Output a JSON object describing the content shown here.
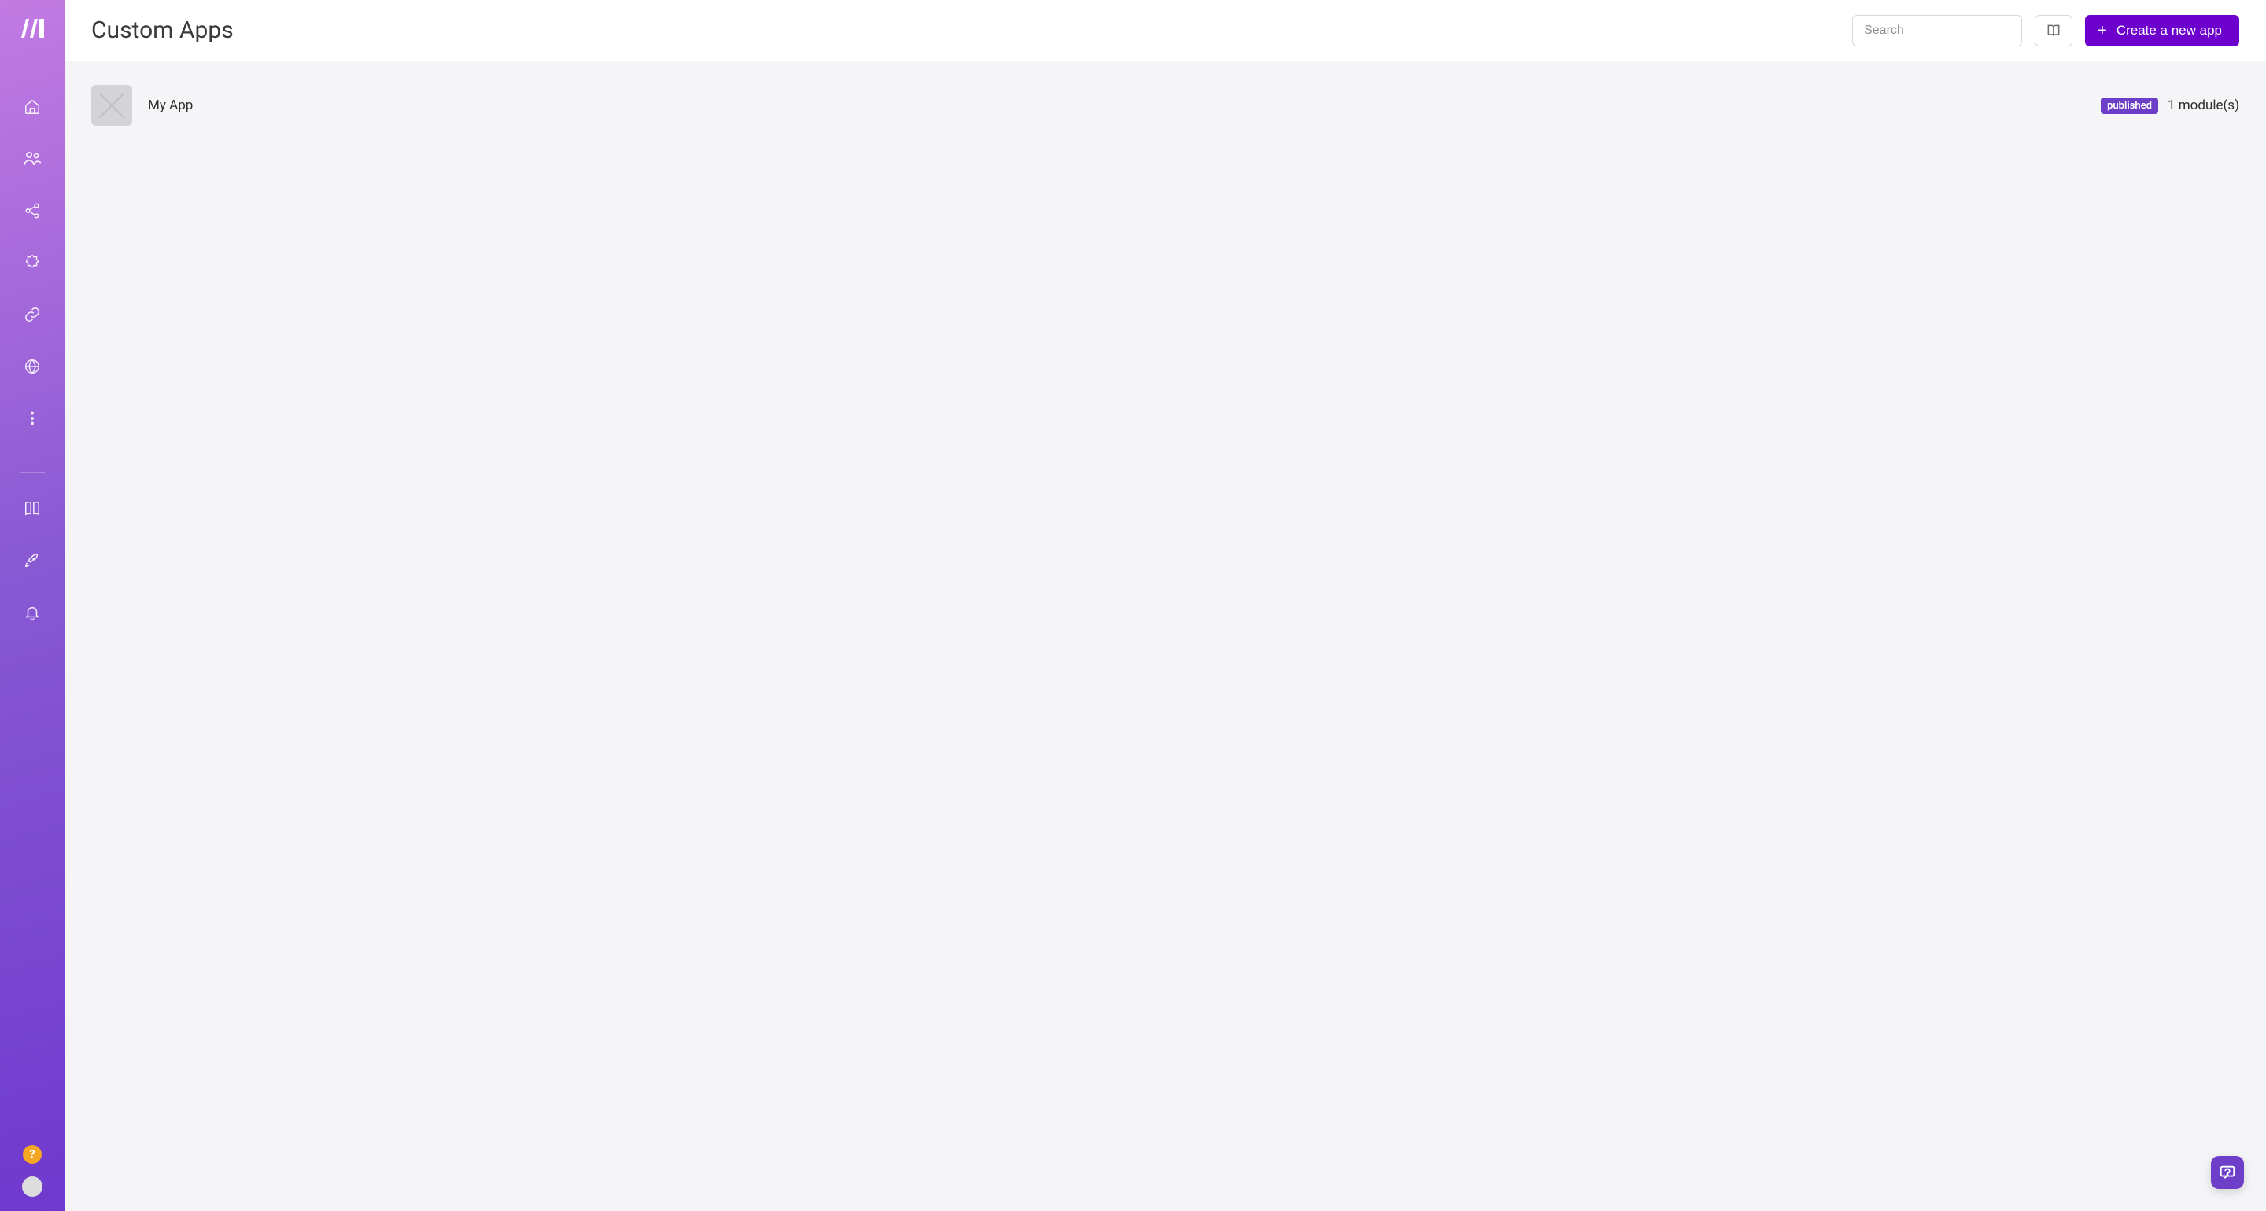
{
  "colors": {
    "primary": "#6d00cc",
    "badge": "#6d3fc9",
    "help": "#f5a623"
  },
  "sidebar": {
    "logo": "make-logo",
    "nav": [
      {
        "id": "home",
        "icon": "home-icon"
      },
      {
        "id": "team",
        "icon": "users-icon"
      },
      {
        "id": "share",
        "icon": "share-icon"
      },
      {
        "id": "apps",
        "icon": "puzzle-icon"
      },
      {
        "id": "links",
        "icon": "link-icon"
      },
      {
        "id": "web",
        "icon": "globe-icon"
      },
      {
        "id": "more",
        "icon": "more-vertical-icon"
      }
    ],
    "secondary": [
      {
        "id": "docs",
        "icon": "book-icon"
      },
      {
        "id": "launch",
        "icon": "rocket-icon"
      },
      {
        "id": "notify",
        "icon": "bell-icon"
      }
    ],
    "help_label": "?",
    "avatar": "user-avatar"
  },
  "header": {
    "title": "Custom Apps",
    "search_placeholder": "Search",
    "docs_button_icon": "book-icon",
    "create_button_label": "Create a new app"
  },
  "apps": [
    {
      "name": "My App",
      "status_badge": "published",
      "module_count_label": "1 module(s)"
    }
  ],
  "floating_help_icon": "help-chat-icon"
}
